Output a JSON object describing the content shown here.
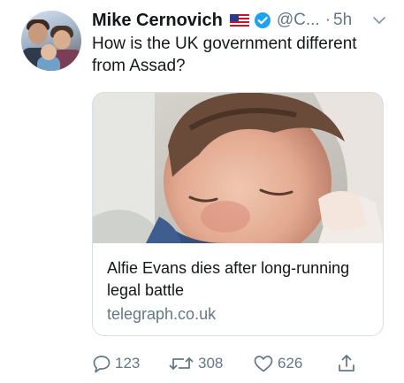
{
  "tweet": {
    "author_name": "Mike Cernovich",
    "handle": "@C...",
    "separator": "·",
    "time": "5h",
    "text": "How is the UK government different from Assad?",
    "flag_icon": "us-flag-icon",
    "verified_icon": "verified-badge-icon"
  },
  "card": {
    "title": "Alfie Evans dies after long-running legal battle",
    "domain": "telegraph.co.uk"
  },
  "actions": {
    "reply_count": "123",
    "retweet_count": "308",
    "like_count": "626"
  },
  "colors": {
    "text": "#14171a",
    "secondary": "#657786",
    "verified": "#1da1f2",
    "border": "#d7dee4"
  }
}
